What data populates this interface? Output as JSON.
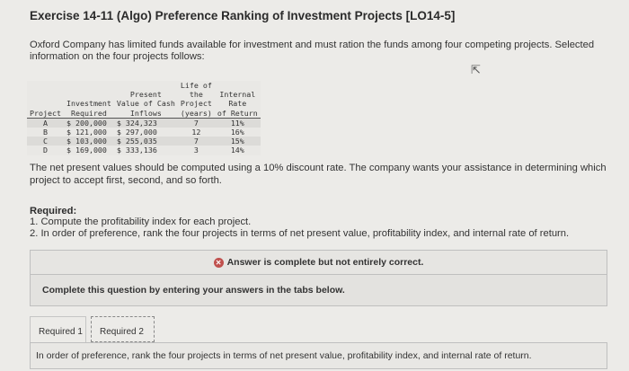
{
  "title": "Exercise 14-11 (Algo) Preference Ranking of Investment Projects [LO14-5]",
  "intro": "Oxford Company has limited funds available for investment and must ration the funds among four competing projects. Selected information on the four projects follows:",
  "table": {
    "headers": [
      "Project",
      "Investment\nRequired",
      "Present\nValue of Cash\nInflows",
      "Life of\nthe\nProject\n(years)",
      "Internal\nRate\nof Return"
    ],
    "rows": [
      [
        "A",
        "$ 200,000",
        "$ 324,323",
        "7",
        "11%"
      ],
      [
        "B",
        "$ 121,000",
        "$ 297,000",
        "12",
        "16%"
      ],
      [
        "C",
        "$ 103,000",
        "$ 255,035",
        "7",
        "15%"
      ],
      [
        "D",
        "$ 169,000",
        "$ 333,136",
        "3",
        "14%"
      ]
    ]
  },
  "npv_text": "The net present values should be computed using a 10% discount rate. The company wants your assistance in determining which project to accept first, second, and so forth.",
  "required": {
    "heading": "Required:",
    "items": [
      "1. Compute the profitability index for each project.",
      "2. In order of preference, rank the four projects in terms of net present value, profitability index, and internal rate of return."
    ]
  },
  "answer_status": "Answer is complete but not entirely correct.",
  "instructions": "Complete this question by entering your answers in the tabs below.",
  "tabs": [
    "Required 1",
    "Required 2"
  ],
  "active_tab_prompt": "In order of preference, rank the four projects in terms of net present value, profitability index, and internal rate of return.",
  "icons": {
    "status": "error-x-icon",
    "cursor": "mouse-cursor-icon"
  }
}
